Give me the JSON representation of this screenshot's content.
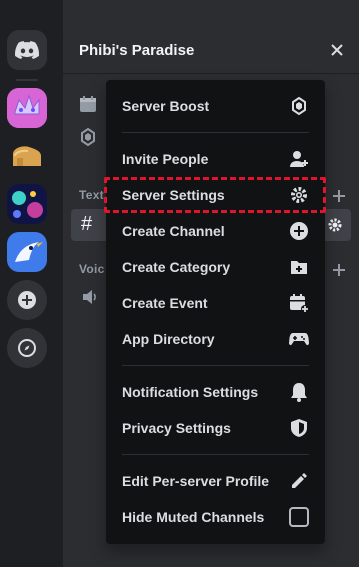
{
  "server": {
    "name": "Phibi's Paradise"
  },
  "panel": {
    "category_text": "Text",
    "category_voice": "Voic",
    "selected_channel_hash": "#"
  },
  "menu": {
    "items": [
      {
        "label": "Server Boost",
        "icon": "boost-gem-icon"
      },
      {
        "label": "Invite People",
        "icon": "add-person-icon"
      },
      {
        "label": "Server Settings",
        "icon": "gear-icon"
      },
      {
        "label": "Create Channel",
        "icon": "plus-circle-icon"
      },
      {
        "label": "Create Category",
        "icon": "add-folder-icon"
      },
      {
        "label": "Create Event",
        "icon": "calendar-add-icon"
      },
      {
        "label": "App Directory",
        "icon": "gamepad-icon"
      },
      {
        "label": "Notification Settings",
        "icon": "bell-icon"
      },
      {
        "label": "Privacy Settings",
        "icon": "shield-icon"
      },
      {
        "label": "Edit Per-server Profile",
        "icon": "pencil-icon"
      },
      {
        "label": "Hide Muted Channels",
        "icon": "checkbox-unchecked"
      }
    ]
  },
  "colors": {
    "rail_bg": "#1e1f22",
    "panel_bg": "#2b2d31",
    "menu_bg": "#111214",
    "highlight": "#e0142d",
    "discord_blurple": "#5865f2"
  }
}
